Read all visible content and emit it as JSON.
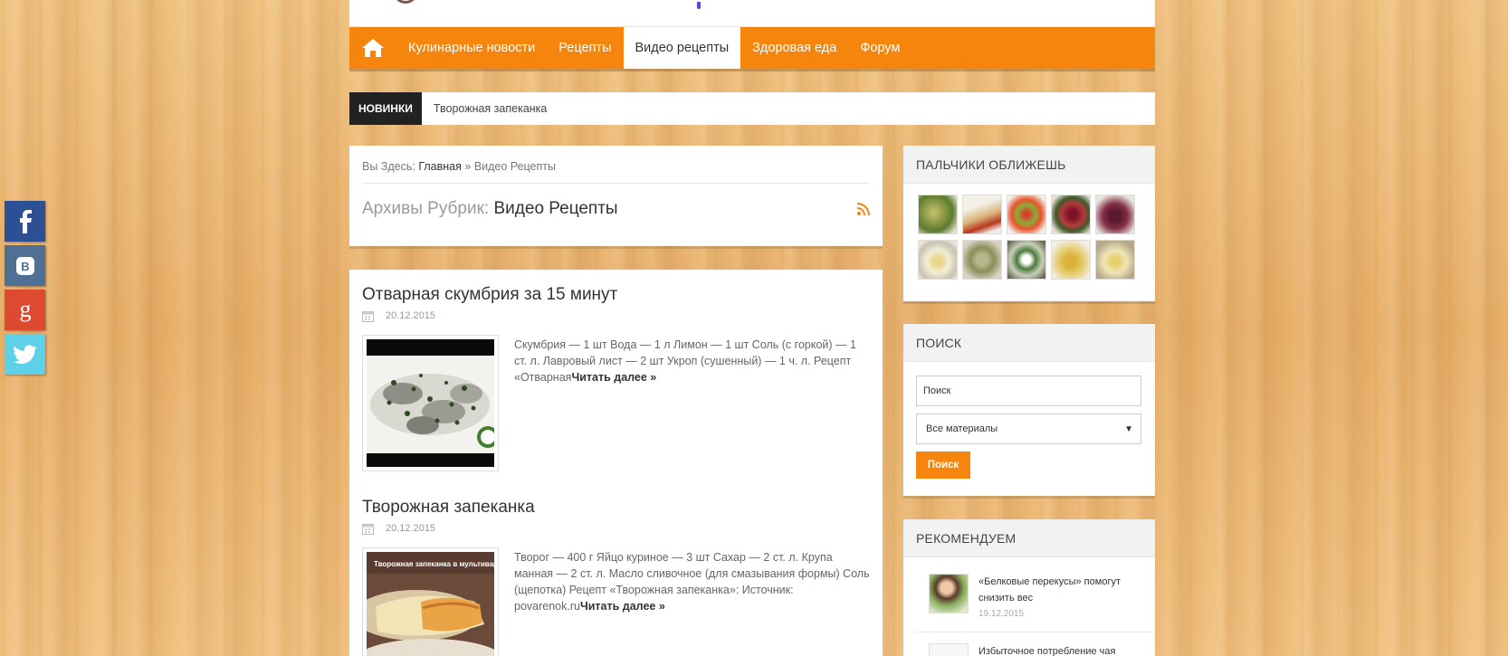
{
  "nav": {
    "home_icon": "home-icon",
    "items": [
      {
        "label": "Кулинарные новости",
        "active": false
      },
      {
        "label": "Рецепты",
        "active": false
      },
      {
        "label": "Видео рецепты",
        "active": true
      },
      {
        "label": "Здоровая еда",
        "active": false
      },
      {
        "label": "Форум",
        "active": false
      }
    ]
  },
  "ticker": {
    "label": "НОВИНКИ",
    "text": "Творожная запеканка"
  },
  "breadcrumb": {
    "prefix": "Вы Здесь:",
    "home": "Главная",
    "sep": "»",
    "current": "Видео Рецепты"
  },
  "archive": {
    "prefix": "Архивы Рубрик:",
    "title": "Видео Рецепты",
    "rss_icon": "rss-icon"
  },
  "posts": [
    {
      "title": "Отварная скумбрия за 15 минут",
      "date": "20.12.2015",
      "excerpt": "Скумбрия — 1 шт Вода — 1 л Лимон — 1 шт Соль (с горкой) — 1 ст. л. Лавровый лист — 2 шт Укроп (сушенный) — 1 ч. л. Рецепт «Отварная",
      "more": "Читать далее »"
    },
    {
      "title": "Творожная запеканка",
      "date": "20.12.2015",
      "excerpt": "Творог — 400 г Яйцо куриное — 3 шт Сахар — 2 ст. л. Крупа манная — 2 ст. л. Масло сливочное (для смазывания формы) Соль (щепотка) Рецепт «Творожная запеканка»: Источник: povarenok.ru",
      "more": "Читать далее »",
      "thumb_caption": "Творожная запеканка в мультиварке"
    }
  ],
  "sidebar": {
    "gallery_title": "ПАЛЬЧИКИ ОБЛИЖЕШЬ",
    "search_title": "ПОИСК",
    "search_value": "Поиск",
    "select_value": "Все материалы",
    "search_button": "Поиск",
    "recommend_title": "РЕКОМЕНДУЕМ",
    "recommend": [
      {
        "title": "«Белковые перекусы» помогут снизить вес",
        "date": "19.12.2015"
      },
      {
        "title": "Избыточное потребление чая"
      }
    ]
  },
  "social": [
    "facebook-icon",
    "vk-icon",
    "google-plus-icon",
    "twitter-icon"
  ],
  "colors": {
    "accent": "#f5850d",
    "dark": "#222222"
  }
}
